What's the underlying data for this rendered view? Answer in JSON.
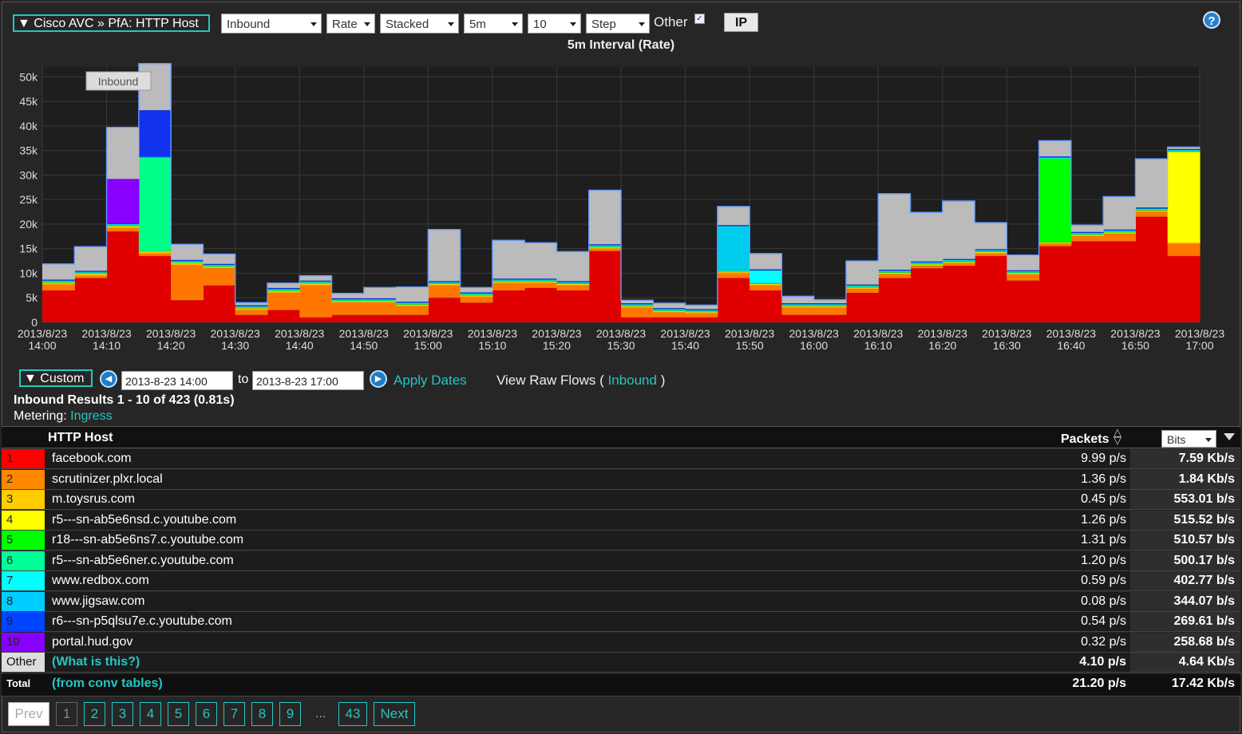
{
  "toolbar": {
    "title": "▼ Cisco AVC » PfA: HTTP Host",
    "direction": "Inbound",
    "mode": "Rate",
    "style": "Stacked",
    "interval": "5m",
    "count": "10",
    "graph": "Step",
    "other_label": "Other",
    "other_checked": true,
    "ip_label": "IP",
    "help": "?"
  },
  "chart_data": {
    "type": "area",
    "title": "5m Interval (Rate)",
    "stacked": true,
    "step": true,
    "legend_label": "Inbound",
    "ylim": [
      0,
      52000
    ],
    "yticks": [
      0,
      5000,
      10000,
      15000,
      20000,
      25000,
      30000,
      35000,
      40000,
      45000,
      50000
    ],
    "ytick_labels": [
      "0",
      "5k",
      "10k",
      "15k",
      "20k",
      "25k",
      "30k",
      "35k",
      "40k",
      "45k",
      "50k"
    ],
    "xtick_labels": [
      "2013/8/23 14:00",
      "2013/8/23 14:10",
      "2013/8/23 14:20",
      "2013/8/23 14:30",
      "2013/8/23 14:40",
      "2013/8/23 14:50",
      "2013/8/23 15:00",
      "2013/8/23 15:10",
      "2013/8/23 15:20",
      "2013/8/23 15:30",
      "2013/8/23 15:40",
      "2013/8/23 15:50",
      "2013/8/23 16:00",
      "2013/8/23 16:10",
      "2013/8/23 16:20",
      "2013/8/23 16:30",
      "2013/8/23 16:40",
      "2013/8/23 16:50",
      "2013/8/23 17:00"
    ],
    "intervals": 36,
    "series": [
      {
        "name": "facebook.com",
        "color": "#e00000",
        "values": [
          6500,
          9000,
          18500,
          13500,
          4500,
          7500,
          1500,
          2500,
          1000,
          1500,
          1500,
          1500,
          5000,
          4000,
          6500,
          7000,
          6500,
          14500,
          1000,
          1000,
          1000,
          9000,
          6500,
          1500,
          1500,
          6000,
          9000,
          11000,
          11500,
          13500,
          8500,
          15500,
          16500,
          16500,
          21500,
          13500
        ]
      },
      {
        "name": "scrutinizer.plxr.local",
        "color": "#ff7700",
        "values": [
          1200,
          500,
          700,
          500,
          7200,
          3500,
          1000,
          3500,
          6500,
          2500,
          2500,
          1800,
          2500,
          1200,
          1500,
          1000,
          1000,
          500,
          2000,
          1000,
          800,
          1000,
          1000,
          1500,
          1500,
          800,
          800,
          500,
          500,
          500,
          1200,
          500,
          1000,
          1500,
          1000,
          2500
        ]
      },
      {
        "name": "m.toysrus.com",
        "color": "#ffbb00",
        "values": [
          300,
          300,
          300,
          300,
          300,
          200,
          300,
          300,
          300,
          200,
          200,
          200,
          200,
          200,
          200,
          200,
          200,
          200,
          200,
          200,
          200,
          200,
          200,
          200,
          200,
          200,
          200,
          200,
          200,
          200,
          200,
          200,
          200,
          200,
          200,
          200
        ]
      },
      {
        "name": "r5---sn-ab5e6nsd.c.youtube.com",
        "color": "#ffff00",
        "values": [
          100,
          100,
          100,
          100,
          100,
          100,
          100,
          100,
          100,
          100,
          100,
          100,
          100,
          100,
          100,
          100,
          100,
          100,
          100,
          100,
          100,
          100,
          100,
          100,
          100,
          100,
          100,
          100,
          100,
          100,
          100,
          100,
          100,
          100,
          100,
          18500
        ]
      },
      {
        "name": "r18---sn-ab5e6ns7.c.youtube.com",
        "color": "#00ff00",
        "values": [
          100,
          100,
          100,
          100,
          100,
          100,
          100,
          100,
          100,
          100,
          100,
          100,
          100,
          100,
          100,
          100,
          100,
          100,
          100,
          100,
          100,
          100,
          100,
          100,
          100,
          100,
          100,
          100,
          100,
          100,
          100,
          17000,
          100,
          100,
          100,
          100
        ]
      },
      {
        "name": "r5---sn-ab5e6ner.c.youtube.com",
        "color": "#00ff88",
        "values": [
          100,
          100,
          100,
          19000,
          100,
          100,
          100,
          100,
          100,
          100,
          100,
          100,
          100,
          100,
          100,
          100,
          100,
          100,
          100,
          100,
          100,
          100,
          100,
          100,
          100,
          100,
          100,
          100,
          100,
          100,
          100,
          100,
          100,
          100,
          100,
          100
        ]
      },
      {
        "name": "www.redbox.com",
        "color": "#00ffff",
        "values": [
          100,
          100,
          100,
          100,
          100,
          100,
          100,
          100,
          100,
          100,
          100,
          100,
          100,
          100,
          100,
          100,
          100,
          100,
          100,
          100,
          100,
          100,
          2500,
          100,
          100,
          100,
          100,
          100,
          100,
          100,
          100,
          100,
          100,
          100,
          100,
          100
        ]
      },
      {
        "name": "www.jigsaw.com",
        "color": "#00ccee",
        "values": [
          100,
          100,
          100,
          100,
          100,
          100,
          100,
          100,
          100,
          100,
          100,
          100,
          100,
          100,
          100,
          100,
          100,
          100,
          100,
          100,
          100,
          9000,
          100,
          100,
          100,
          100,
          100,
          100,
          100,
          100,
          100,
          100,
          100,
          100,
          100,
          100
        ]
      },
      {
        "name": "r6---sn-p5qlsu7e.c.youtube.com",
        "color": "#1133ee",
        "values": [
          200,
          200,
          200,
          9500,
          200,
          200,
          200,
          200,
          200,
          200,
          200,
          200,
          200,
          200,
          200,
          200,
          200,
          200,
          200,
          200,
          200,
          200,
          200,
          200,
          200,
          200,
          200,
          200,
          200,
          200,
          200,
          200,
          200,
          200,
          200,
          200
        ]
      },
      {
        "name": "portal.hud.gov",
        "color": "#8800ff",
        "values": [
          0,
          0,
          9000,
          0,
          0,
          0,
          0,
          0,
          0,
          0,
          0,
          0,
          0,
          0,
          0,
          0,
          0,
          0,
          0,
          0,
          0,
          0,
          0,
          0,
          0,
          0,
          0,
          0,
          0,
          0,
          0,
          0,
          0,
          0,
          0,
          0
        ]
      },
      {
        "name": "Other",
        "color": "#bbbbbb",
        "values": [
          3200,
          4900,
          10500,
          9500,
          3200,
          2000,
          500,
          1000,
          1000,
          1000,
          2200,
          3000,
          10500,
          1000,
          7800,
          7300,
          6000,
          11000,
          600,
          1000,
          800,
          3800,
          3200,
          1400,
          700,
          4800,
          15500,
          10000,
          11800,
          5400,
          3100,
          3200,
          1400,
          6700,
          9900,
          400
        ]
      }
    ]
  },
  "dates": {
    "range_label": "▼ Custom",
    "from": "2013-8-23 14:00",
    "to_label": "to",
    "to": "2013-8-23 17:00",
    "apply": "Apply Dates",
    "raw_prefix": "View Raw Flows (",
    "raw_link": "Inbound",
    "raw_suffix": ")"
  },
  "results": {
    "summary": "Inbound Results 1 - 10 of 423 (0.81s)",
    "metering_label": "Metering:",
    "metering_value": "Ingress"
  },
  "table": {
    "col_host": "HTTP Host",
    "col_packets": "Packets",
    "unit_select": "Bits",
    "rows": [
      {
        "rank": "1",
        "color": "#ff0000",
        "host": "facebook.com",
        "packets": "9.99 p/s",
        "bits": "7.59 Kb/s"
      },
      {
        "rank": "2",
        "color": "#ff8800",
        "host": "scrutinizer.plxr.local",
        "packets": "1.36 p/s",
        "bits": "1.84 Kb/s"
      },
      {
        "rank": "3",
        "color": "#ffcc00",
        "host": "m.toysrus.com",
        "packets": "0.45 p/s",
        "bits": "553.01 b/s"
      },
      {
        "rank": "4",
        "color": "#ffff00",
        "host": "r5---sn-ab5e6nsd.c.youtube.com",
        "packets": "1.26 p/s",
        "bits": "515.52 b/s"
      },
      {
        "rank": "5",
        "color": "#00ff00",
        "host": "r18---sn-ab5e6ns7.c.youtube.com",
        "packets": "1.31 p/s",
        "bits": "510.57 b/s"
      },
      {
        "rank": "6",
        "color": "#00ff99",
        "host": "r5---sn-ab5e6ner.c.youtube.com",
        "packets": "1.20 p/s",
        "bits": "500.17 b/s"
      },
      {
        "rank": "7",
        "color": "#00ffff",
        "host": "www.redbox.com",
        "packets": "0.59 p/s",
        "bits": "402.77 b/s"
      },
      {
        "rank": "8",
        "color": "#00ccff",
        "host": "www.jigsaw.com",
        "packets": "0.08 p/s",
        "bits": "344.07 b/s"
      },
      {
        "rank": "9",
        "color": "#0044ff",
        "host": "r6---sn-p5qlsu7e.c.youtube.com",
        "packets": "0.54 p/s",
        "bits": "269.61 b/s"
      },
      {
        "rank": "10",
        "color": "#8800ff",
        "host": "portal.hud.gov",
        "packets": "0.32 p/s",
        "bits": "258.68 b/s"
      }
    ],
    "other": {
      "rank": "Other",
      "host": "(What is this?)",
      "packets": "4.10 p/s",
      "bits": "4.64 Kb/s"
    },
    "total": {
      "rank": "Total",
      "host": "(from conv tables)",
      "packets": "21.20 p/s",
      "bits": "17.42 Kb/s"
    }
  },
  "pager": {
    "prev": "Prev",
    "pages": [
      "1",
      "2",
      "3",
      "4",
      "5",
      "6",
      "7",
      "8",
      "9"
    ],
    "ellipsis": "...",
    "last": "43",
    "next": "Next"
  }
}
